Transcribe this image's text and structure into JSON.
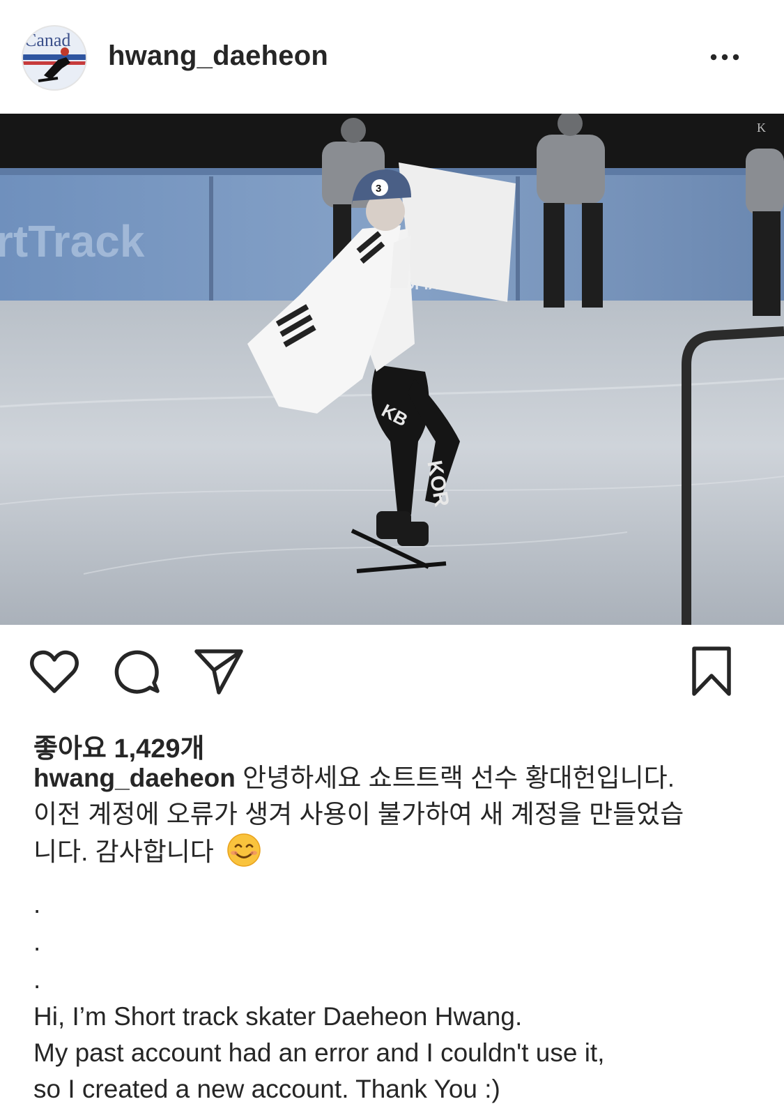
{
  "header": {
    "username": "hwang_daeheon",
    "avatar_text": "Canad",
    "more_icon": "more-horizontal-icon"
  },
  "photo": {
    "rink_banner_text": "rtTrack",
    "sponsor_text": "OFIX",
    "helmet_number": "3",
    "suit_logo": "KB",
    "suit_text": "KOR",
    "corner_mark": "K"
  },
  "actions": {
    "like_icon": "heart-icon",
    "comment_icon": "comment-icon",
    "share_icon": "send-icon",
    "save_icon": "bookmark-icon"
  },
  "likes": {
    "text": "좋아요 1,429개"
  },
  "caption": {
    "username": "hwang_daeheon",
    "korean_line1": "안녕하세요 쇼트트랙 선수 황대헌입니다.",
    "korean_line2": "이전 계정에 오류가 생겨 사용이 불가하여 새 계정을 만들었습",
    "korean_line3": "니다. 감사합니다",
    "emoji": "smiling-face-icon",
    "dots": [
      ".",
      ".",
      "."
    ],
    "english_line1": "Hi, I’m Short track skater Daeheon Hwang.",
    "english_line2": "My past account had an error and I couldn't use it,",
    "english_line3": "so I created a new account. Thank You :)"
  },
  "colors": {
    "text": "#262626",
    "background": "#ffffff",
    "rink_banner": "#7e9cc4",
    "ice": "#c9ced4"
  }
}
